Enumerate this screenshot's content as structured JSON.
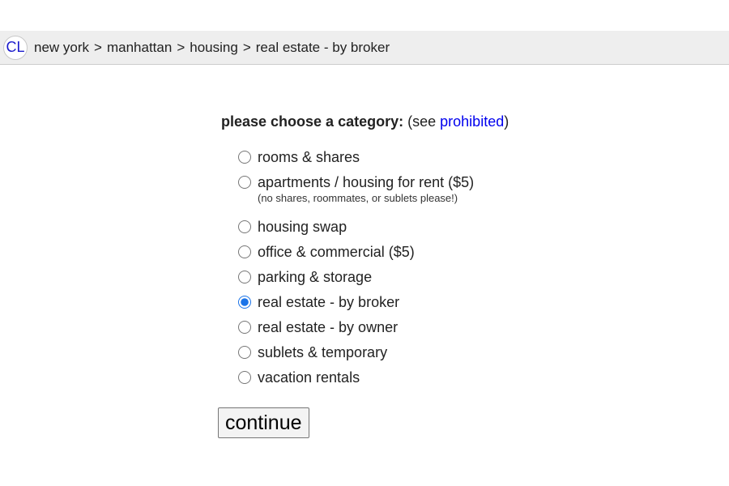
{
  "header": {
    "logo": "CL",
    "breadcrumb": [
      "new york",
      "manhattan",
      "housing",
      "real estate - by broker"
    ],
    "separator": ">"
  },
  "main": {
    "heading_bold": "please choose a category:",
    "heading_pre": "(see ",
    "heading_link": "prohibited",
    "heading_post": ")",
    "options": [
      {
        "label": "rooms & shares",
        "note": "",
        "checked": false
      },
      {
        "label": "apartments / housing for rent ($5)",
        "note": "(no shares, roommates, or sublets please!)",
        "checked": false
      },
      {
        "label": "housing swap",
        "note": "",
        "checked": false
      },
      {
        "label": "office & commercial ($5)",
        "note": "",
        "checked": false
      },
      {
        "label": "parking & storage",
        "note": "",
        "checked": false
      },
      {
        "label": "real estate - by broker",
        "note": "",
        "checked": true
      },
      {
        "label": "real estate - by owner",
        "note": "",
        "checked": false
      },
      {
        "label": "sublets & temporary",
        "note": "",
        "checked": false
      },
      {
        "label": "vacation rentals",
        "note": "",
        "checked": false
      }
    ],
    "continue_label": "continue"
  },
  "colors": {
    "header_bg": "#eeeeee",
    "link": "#0000ee",
    "logo_text": "#1a1acc",
    "radio_selected": "#1a73e8"
  }
}
